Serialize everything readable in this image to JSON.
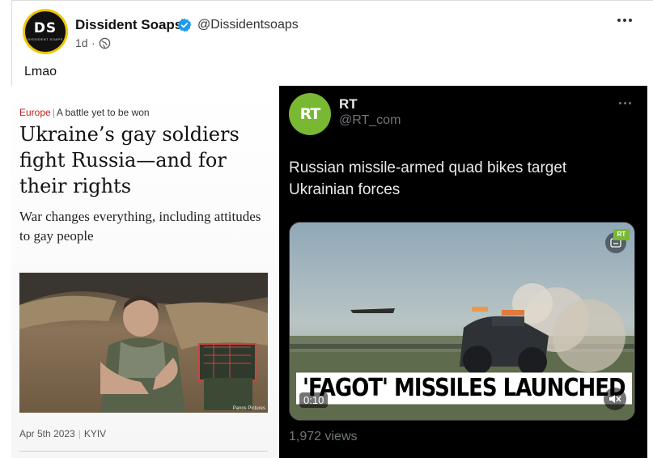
{
  "post": {
    "author_name": "Dissident Soaps",
    "author_handle": "@Dissidentsoaps",
    "avatar_text": "DS",
    "avatar_subtext": "DISSIDENT SOAPS",
    "time": "1d",
    "separator": "·",
    "text": "Lmao",
    "verified_icon": "verified-badge-icon",
    "visibility_icon": "globe-icon",
    "more_icon": "more-options-icon"
  },
  "article": {
    "section": "Europe",
    "kicker": "A battle yet to be won",
    "headline": "Ukraine’s gay soldiers fight Russia—and for their rights",
    "subhead": "War changes everything, including attitudes to gay people",
    "date": "Apr 5th 2023",
    "location": "KYIV",
    "photo_credit": "Panos Pictures"
  },
  "tweet": {
    "avatar_text": "RT",
    "name": "RT",
    "handle": "@RT_com",
    "text": "Russian missile-armed quad bikes target Ukrainian forces",
    "video_caption": "'FAGOT' MISSILES LAUNCHED",
    "video_time": "0:10",
    "watermark": "RT",
    "views": "1,972 views"
  },
  "colors": {
    "verified_blue": "#1d9bf0",
    "rt_green": "#78b833",
    "economist_red": "#c0211f"
  }
}
